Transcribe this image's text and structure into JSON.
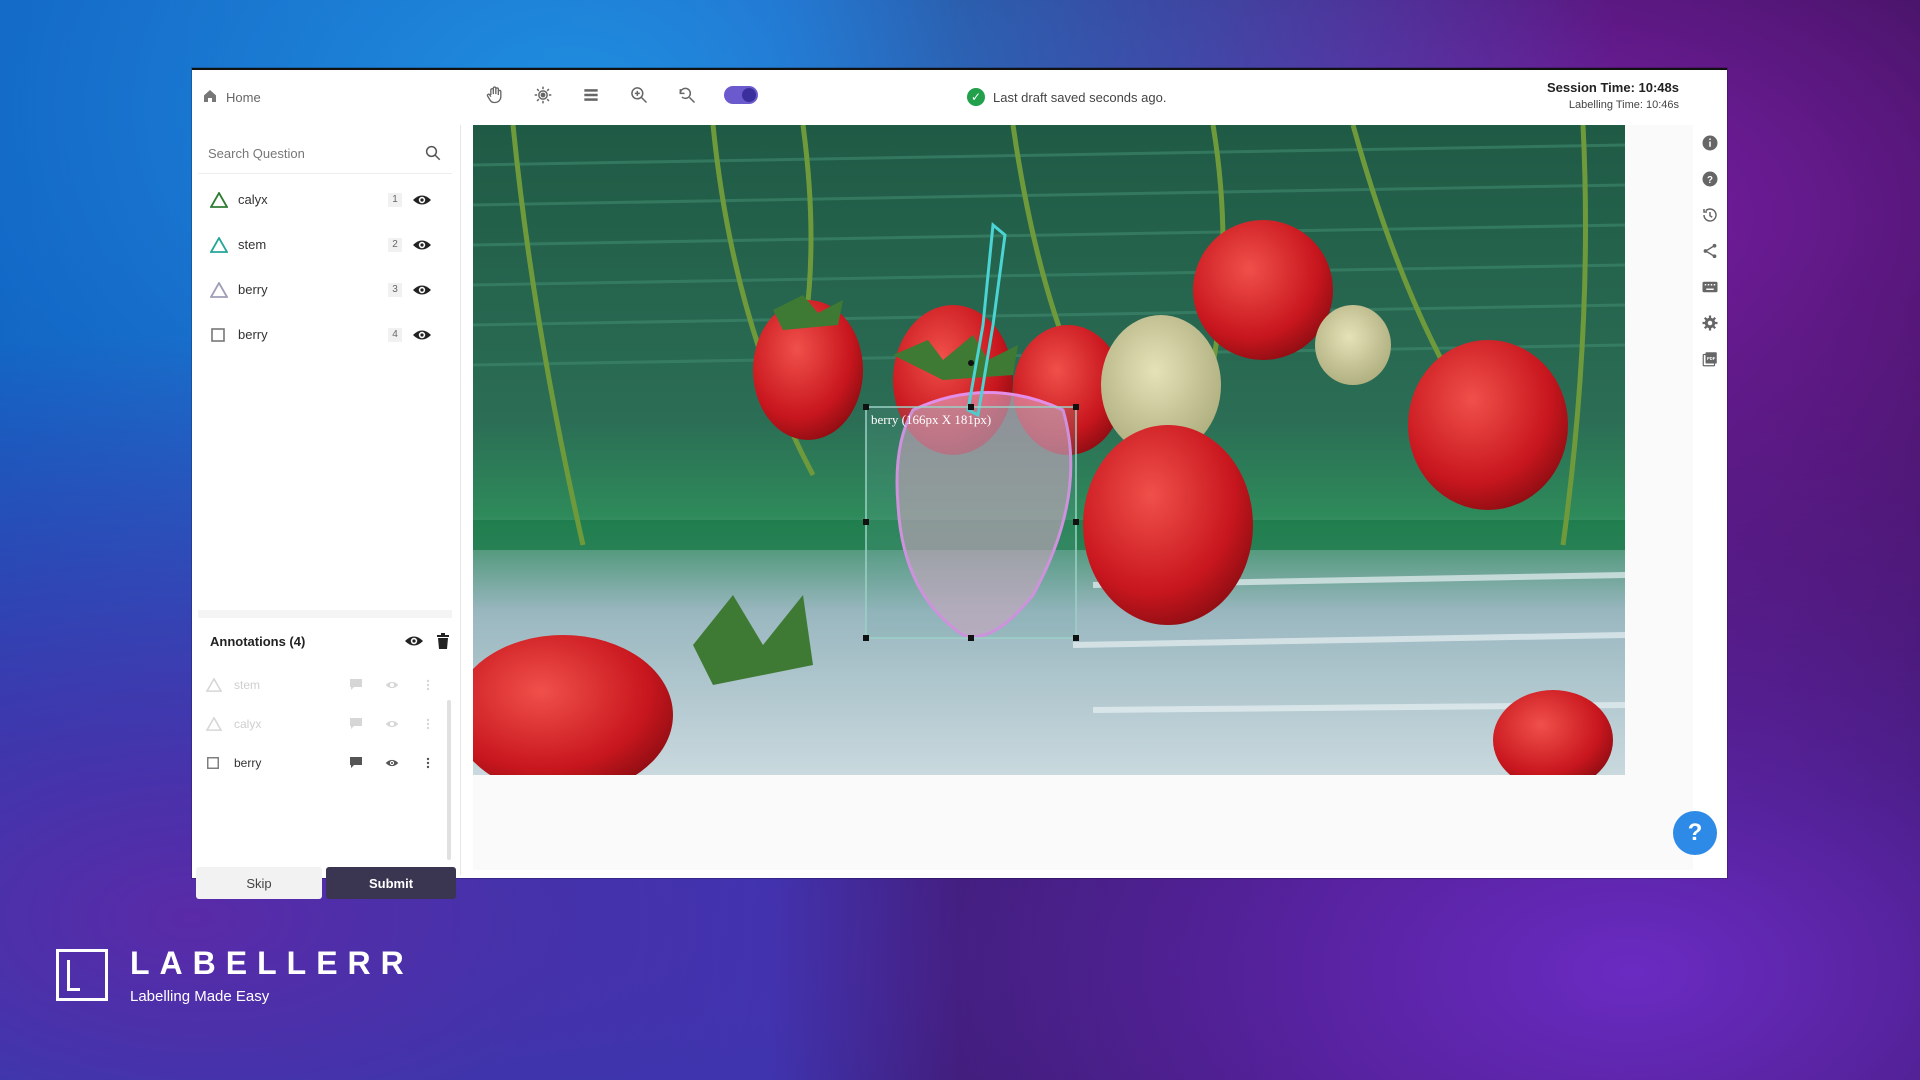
{
  "topbar": {
    "home_label": "Home",
    "saved_text": "Last draft saved seconds ago.",
    "session_time": "Session Time: 10:48s",
    "labelling_time": "Labelling Time: 10:46s"
  },
  "search": {
    "placeholder": "Search Question"
  },
  "questions": [
    {
      "label": "calyx",
      "num": "1",
      "shape": "polygon",
      "color": "#2e7d32"
    },
    {
      "label": "stem",
      "num": "2",
      "shape": "polygon",
      "color": "#26a69a"
    },
    {
      "label": "berry",
      "num": "3",
      "shape": "polygon",
      "color": "#9e9eb8"
    },
    {
      "label": "berry",
      "num": "4",
      "shape": "box",
      "color": "#777777"
    }
  ],
  "annotations": {
    "header": "Annotations (4)",
    "items": [
      {
        "label": "stem",
        "faded": true
      },
      {
        "label": "calyx",
        "faded": true
      },
      {
        "label": "berry",
        "faded": false
      }
    ]
  },
  "buttons": {
    "skip": "Skip",
    "submit": "Submit"
  },
  "canvas": {
    "bbox_label": "berry (166px X 181px)"
  },
  "help_label": "?",
  "brand": {
    "name": "LABELLERR",
    "tagline": "Labelling Made Easy"
  }
}
